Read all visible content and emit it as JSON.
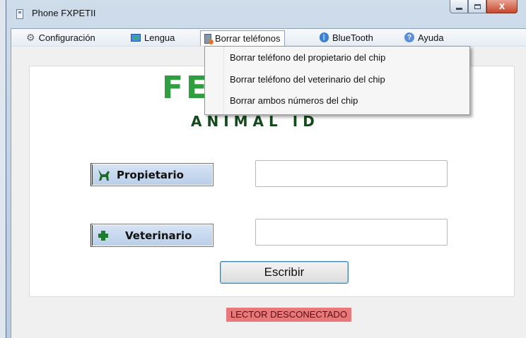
{
  "window": {
    "title": "Phone FXPETII",
    "minimize_label": "Minimize",
    "maximize_label": "Maximize",
    "close_label": "X"
  },
  "menu": {
    "items": [
      {
        "label": "Configuración",
        "icon": "gear-icon"
      },
      {
        "label": "Lengua",
        "icon": "language-icon"
      },
      {
        "label": "Borrar teléfonos",
        "icon": "phone-delete-icon"
      },
      {
        "label": "BlueTooth",
        "icon": "bluetooth-icon"
      },
      {
        "label": "Ayuda",
        "icon": "help-icon"
      }
    ],
    "open_menu": "Borrar teléfonos",
    "dropdown": [
      "Borrar teléfono del propietario del chip",
      "Borrar teléfono del veterinario del chip",
      "Borrar ambos números del chip"
    ]
  },
  "logo": {
    "main": "FE",
    "sub": "ANIMAL ID",
    "color": "#2e9e3e"
  },
  "form": {
    "owner_button": "Propietario",
    "owner_value": "",
    "vet_button": "Veterinario",
    "vet_value": "",
    "write_button": "Escribir"
  },
  "status": {
    "text": "LECTOR DESCONECTADO",
    "color": "#e8797b"
  }
}
